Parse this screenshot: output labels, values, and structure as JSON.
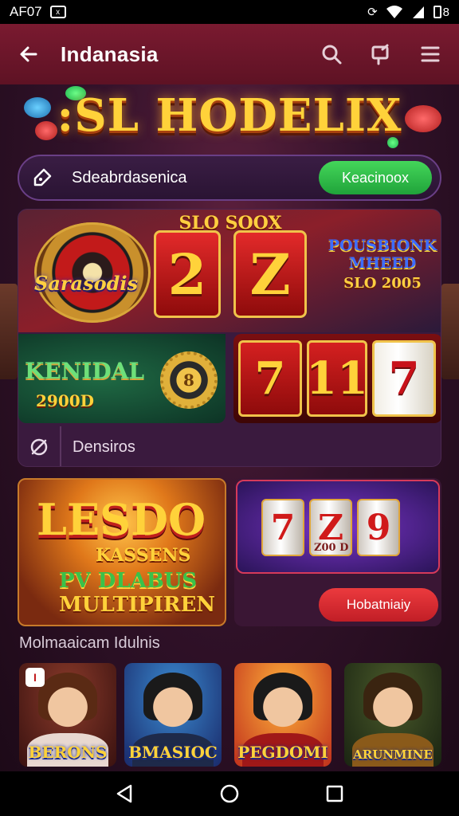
{
  "status_bar": {
    "time": "AF07",
    "notif_glyph": "x",
    "battery": "8"
  },
  "app_bar": {
    "title": "Indanasia"
  },
  "banner": {
    "logo": ":SL HODELIX"
  },
  "search": {
    "text": "Sdeabrdasenica",
    "button": "Keacinoox"
  },
  "featured": {
    "top_text": "SLO SOOX",
    "roulette_label": "Sarasodis",
    "reels": [
      "2",
      "Z"
    ],
    "promo_title": "POUSBIONK MHEED",
    "promo_amount": "SLO 2005",
    "side_title": "KENIDAL",
    "side_amount": "2900D",
    "gear_symbol": "8",
    "reels_row": [
      "7",
      "11",
      "7"
    ],
    "footer_text": "Densiros"
  },
  "promo": {
    "big_line1": "LESDO",
    "big_line2": "KASSENS",
    "big_line3": "PV DLABUS",
    "big_line4": "MULTIPIREN",
    "slot_reels": [
      "7",
      "Z",
      "9"
    ],
    "slot_caption": "Z00 D",
    "slot_button": "Hobatniaiy"
  },
  "section": {
    "title": "Molmaaicam Idulnis",
    "tiles": [
      {
        "label": "BERONS",
        "badge": "I"
      },
      {
        "label": "BMASIOC",
        "badge": ""
      },
      {
        "label": "PEGDOMI",
        "badge": ""
      },
      {
        "label": "ARUNMINE",
        "badge": ""
      }
    ]
  },
  "colors": {
    "brand": "#7a1a30",
    "accent_green": "#2fbf46",
    "accent_red": "#e0262e",
    "gold": "#ffd23a"
  }
}
